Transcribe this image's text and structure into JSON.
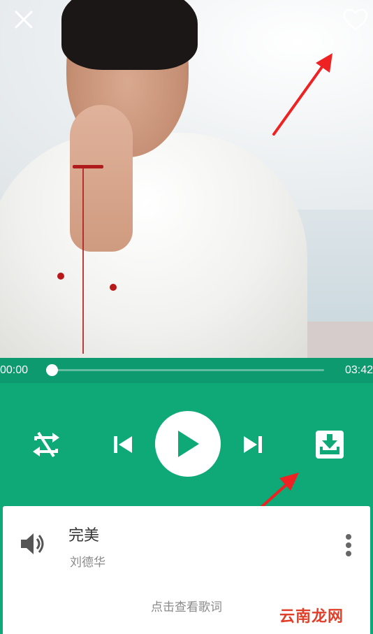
{
  "player": {
    "current_time": "00:00",
    "total_time": "03:42",
    "progress": 0.0,
    "accent_color": "#0fa877"
  },
  "top_bar": {
    "close_icon": "close-icon",
    "favorite_icon": "heart-outline-icon"
  },
  "controls": {
    "repeat_icon": "repeat-off-icon",
    "prev_icon": "skip-previous-icon",
    "play_icon": "play-icon",
    "next_icon": "skip-next-icon",
    "download_icon": "download-icon"
  },
  "track": {
    "title": "完美",
    "artist": "刘德华",
    "lyrics_hint": "点击查看歌词",
    "speaker_icon": "volume-icon",
    "more_icon": "more-vertical-icon"
  },
  "watermark": "云南龙网",
  "annotations": {
    "arrow_color": "#ee2222"
  }
}
